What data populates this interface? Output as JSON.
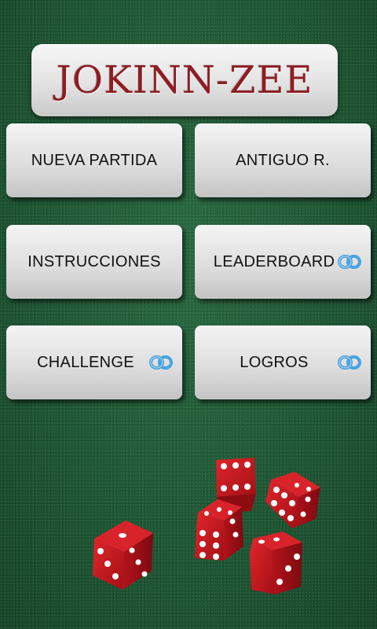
{
  "app": {
    "logo_title": "JOKINN-ZEE"
  },
  "menu": {
    "new_game": "NUEVA PARTIDA",
    "old_record": "ANTIGUO R.",
    "instructions": "INSTRUCCIONES",
    "leaderboard": "LEADERBOARD",
    "challenge": "CHALLENGE",
    "achievements": "LOGROS"
  },
  "icons": {
    "online_link": "link-icon"
  },
  "colors": {
    "felt": "#1f5a35",
    "logo_text": "#8e1d22",
    "dice_red": "#c5141b",
    "link_icon": "#4aa3df"
  }
}
